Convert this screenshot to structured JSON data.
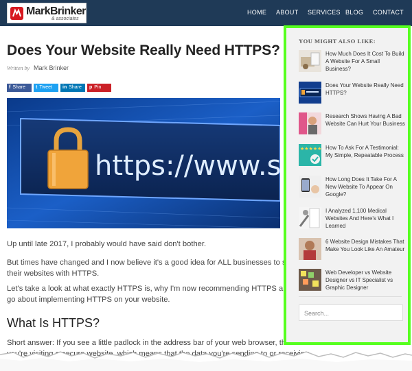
{
  "header": {
    "logo_text": "MarkBrinker",
    "logo_sub": "& associates",
    "nav": [
      "HOME",
      "ABOUT",
      "SERVICES",
      "BLOG",
      "CONTACT"
    ]
  },
  "article": {
    "title": "Does Your Website Really Need HTTPS?",
    "byline_prefix": "Written by",
    "author": "Mark Brinker",
    "share_buttons": [
      {
        "icon": "f",
        "label": "Share",
        "color": "#3b5998"
      },
      {
        "icon": "t",
        "label": "Tweet",
        "color": "#1da1f2"
      },
      {
        "icon": "in",
        "label": "Share",
        "color": "#0077b5"
      },
      {
        "icon": "p",
        "label": "Pin",
        "color": "#cb2027"
      }
    ],
    "hero_text": "https://www.ssl",
    "paragraphs": [
      [
        "Up until late 2017, I probably would have said don't bother."
      ],
      [
        "But times have changed and I now believe it's a good idea for ALL businesses to secure",
        "their websites with HTTPS."
      ],
      [
        "Let's take a look at what exactly HTTPS is, why I'm now recommending HTTPS and how you",
        "go about implementing HTTPS on your website."
      ]
    ],
    "heading": "What Is HTTPS?",
    "last_para": [
      "Short answer: If you see a little padlock in the address bar of your web browser, that means",
      "you're visiting a secure website, which means that the data you're sending to or receiving"
    ]
  },
  "sidebar": {
    "title": "YOU MIGHT ALSO LIKE:",
    "items": [
      {
        "title": "How Much Does It Cost To Build A Website For A Small Business?"
      },
      {
        "title": "Does Your Website Really Need HTTPS?"
      },
      {
        "title": "Research Shows Having A Bad Website Can Hurt Your Business"
      },
      {
        "title": "How To Ask For A Testimonial: My Simple, Repeatable Process"
      },
      {
        "title": "How Long Does It Take For A New Website To Appear On Google?"
      },
      {
        "title": "I Analyzed 1,100 Medical Websites And Here's What I Learned"
      },
      {
        "title": "6 Website Design Mistakes That Make You Look Like An Amateur"
      },
      {
        "title": "Web Developer vs Website Designer vs IT Specialist vs Graphic Designer"
      }
    ],
    "search_placeholder": "Search..."
  },
  "colors": {
    "header_bg": "#1f3a57",
    "highlight_border": "#56ff1f",
    "logo_red": "#d71920"
  }
}
